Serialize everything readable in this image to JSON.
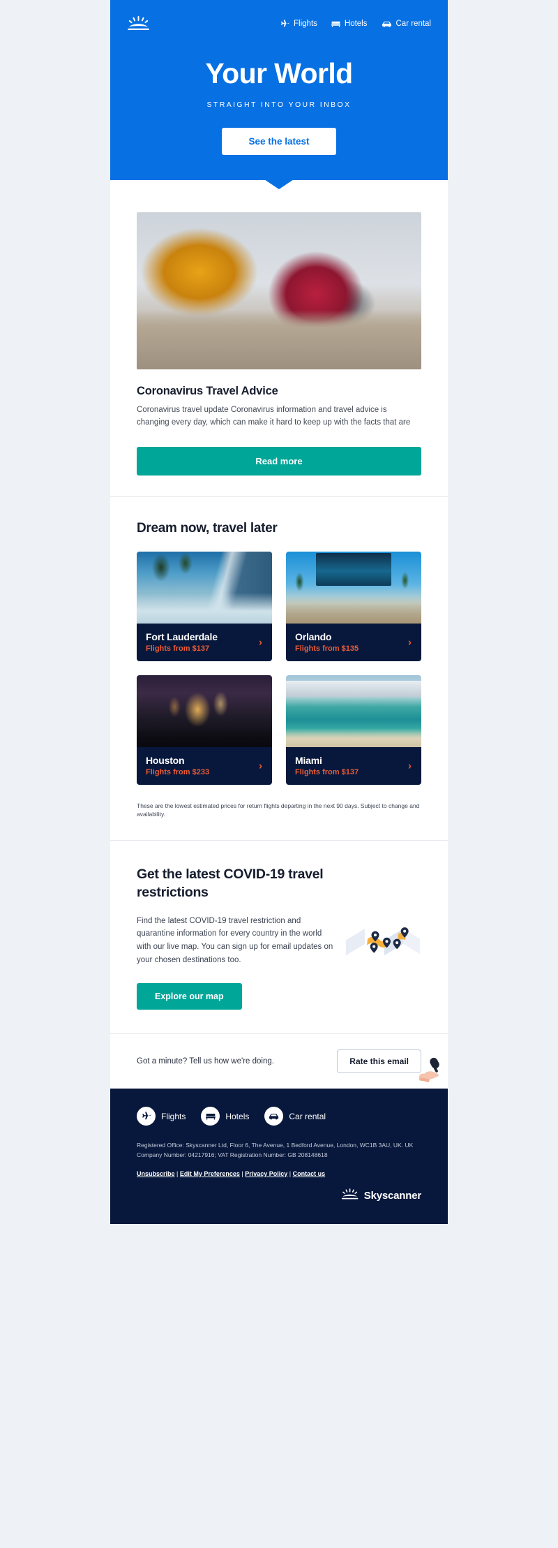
{
  "hero": {
    "logo_icon": "skyscanner-sunrise-logo-icon",
    "nav": [
      {
        "label": "Flights",
        "icon": "plane-icon"
      },
      {
        "label": "Hotels",
        "icon": "bed-icon"
      },
      {
        "label": "Car rental",
        "icon": "car-icon"
      }
    ],
    "title": "Your World",
    "subtitle": "STRAIGHT INTO YOUR INBOX",
    "cta_label": "See the latest",
    "bg_color": "#0770e3",
    "cta_text_color": "#0770e3"
  },
  "article": {
    "image_alt": "two hikers helping each other up a rock face",
    "title": "Coronavirus Travel Advice",
    "body": "Coronavirus travel update Coronavirus information and travel advice is changing every day, which can make it hard to keep up with the facts that are",
    "cta_label": "Read more",
    "cta_color": "#00a698"
  },
  "destinations": {
    "title": "Dream now, travel later",
    "arrow_icon": "chevron-right-icon",
    "cards": [
      {
        "name": "Fort Lauderdale",
        "price": "Flights from $137",
        "photo": "fll"
      },
      {
        "name": "Orlando",
        "price": "Flights from $135",
        "photo": "mco"
      },
      {
        "name": "Houston",
        "price": "Flights from $233",
        "photo": "hou"
      },
      {
        "name": "Miami",
        "price": "Flights from $137",
        "photo": "mia"
      }
    ],
    "note": "These are the lowest estimated prices for return flights departing in the next 90 days. Subject to change and availability.",
    "label_bg": "#08183c",
    "price_color": "#eb5b35"
  },
  "covid": {
    "title": "Get the latest COVID-19 travel restrictions",
    "body": "Find the latest COVID-19 travel restriction and quarantine information for every country in the world with our live map. You can sign up for email updates on your chosen destinations too.",
    "cta_label": "Explore our map",
    "illustration_icon": "folded-map-with-pins-icon"
  },
  "rate": {
    "text": "Got a minute? Tell us how we're doing.",
    "button_label": "Rate this email",
    "illustration_icon": "hand-holding-microphone-icon"
  },
  "footer": {
    "nav": [
      {
        "label": "Flights",
        "icon": "plane-icon"
      },
      {
        "label": "Hotels",
        "icon": "bed-icon"
      },
      {
        "label": "Car rental",
        "icon": "car-icon"
      }
    ],
    "legal_line1": "Registered Office: Skyscanner Ltd, Floor 6, The Avenue, 1 Bedford Avenue, London, WC1B 3AU, UK. UK",
    "legal_line2": "Company Number: 04217916; VAT Registration Number: GB 208148618",
    "links": [
      {
        "label": "Unsubscribe"
      },
      {
        "label": "Edit My Preferences"
      },
      {
        "label": "Privacy Policy"
      },
      {
        "label": "Contact us"
      }
    ],
    "separator": " | ",
    "brand_name": "Skyscanner",
    "brand_icon": "skyscanner-sunrise-logo-icon",
    "bg_color": "#08183c"
  }
}
